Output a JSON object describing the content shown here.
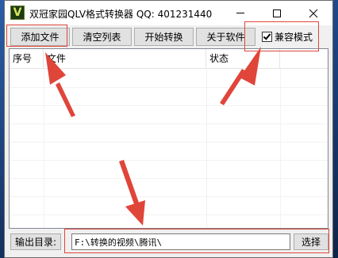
{
  "window": {
    "title": "双冠家园QLV格式转换器 QQ: 401231440",
    "app_icon_letter": "V",
    "controls": [
      "minimize",
      "maximize",
      "close"
    ]
  },
  "toolbar": {
    "add_file": "添加文件",
    "clear_list": "清空列表",
    "start_convert": "开始转换",
    "about": "关于软件",
    "compat_mode": "兼容模式",
    "compat_checked": true
  },
  "list": {
    "columns": [
      "序号",
      "文件",
      "状态",
      ""
    ],
    "rows": []
  },
  "output": {
    "label": "输出目录:",
    "path": "F:\\转换的视频\\腾讯\\",
    "browse": "选择"
  },
  "annotation_color": "#e0453a",
  "icons": {
    "close": "close-icon",
    "app": "app-icon"
  }
}
